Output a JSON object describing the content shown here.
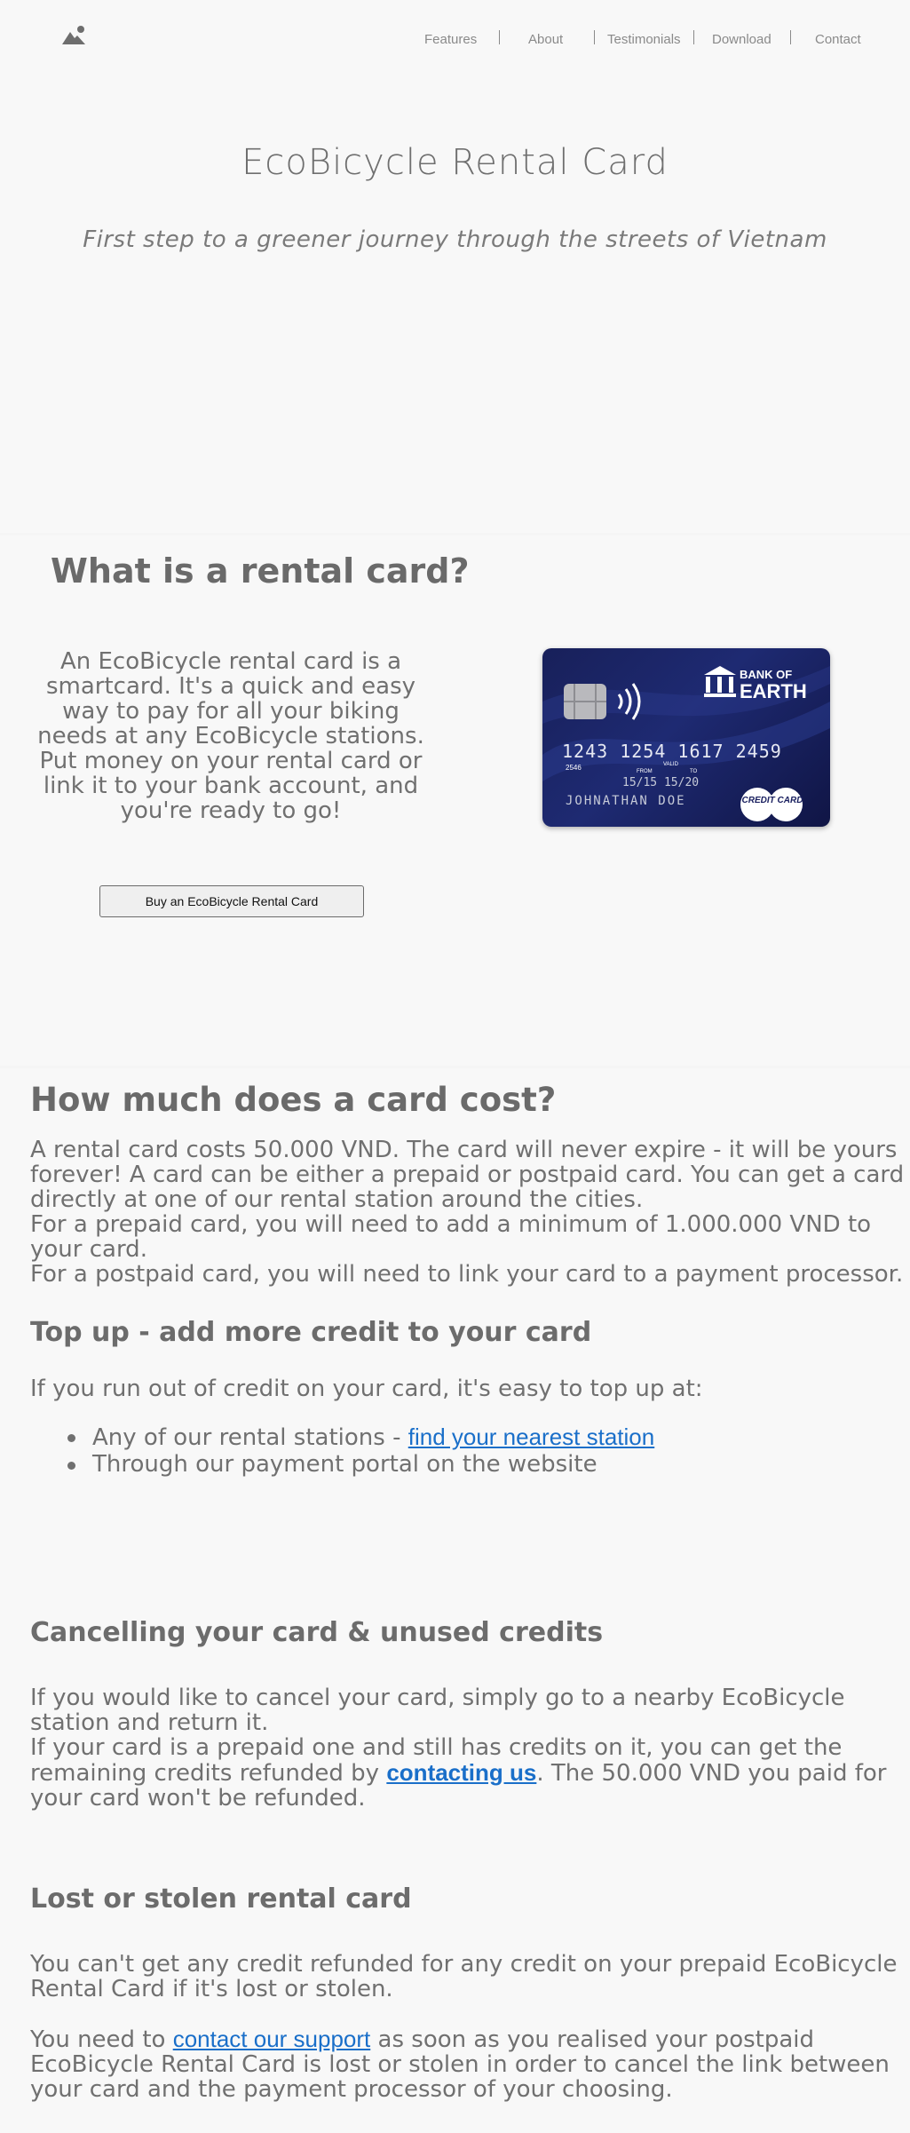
{
  "nav": {
    "items": [
      "Features",
      "About",
      "Testimonials",
      "Download",
      "Contact"
    ],
    "logo_icon": "mountain-sun-icon"
  },
  "hero": {
    "title": "EcoBicycle Rental Card",
    "subtitle": "First step to a greener journey through the streets of Vietnam"
  },
  "what": {
    "title": "What is a rental card?",
    "body": "An EcoBicycle rental card is a smartcard. It's a quick and easy way to pay for all your biking needs at any EcoBicycle stations. Put money on your rental card or link it to your bank account, and you're ready to go!",
    "button": "Buy an EcoBicycle Rental Card",
    "card": {
      "bank_line1": "BANK OF",
      "bank_line2": "EARTH",
      "number": "1243 1254 1617 2459",
      "small_number": "2546",
      "from_label": "FROM",
      "valid_label": "VALID",
      "to_label": "TO",
      "expiry": "15/15  15/20",
      "holder": "JOHNATHAN DOE",
      "type": "CREDIT CARD"
    }
  },
  "cost": {
    "title": "How much does a card cost?",
    "p1": "A rental card costs 50.000 VND. The card will never expire - it will be yours forever! A card can be either a prepaid or postpaid card. You can get a card directly at one of our rental station around the cities.",
    "p2": "For a prepaid card, you will need to add a minimum of 1.000.000 VND to your card.",
    "p3": "For a postpaid card, you will need to link your card to a payment processor.",
    "topup_title": "Top up - add more credit to your card",
    "topup_intro": "If you run out of credit on your card, it's easy to top up at:",
    "topup_item1": "Any of our rental stations - ",
    "topup_item1_link": "find your nearest station",
    "topup_item2": "Through our payment portal on the website",
    "cancel_title": "Cancelling your card & unused credits",
    "cancel_p1": "If you would like to cancel your card, simply go to a nearby EcoBicycle station and return it.",
    "cancel_p2a": "If your card is a prepaid one and still has credits on it, you can get the remaining credits refunded by ",
    "cancel_p2_link": "contacting us",
    "cancel_p2b": ". The 50.000 VND you paid for your card won't be refunded.",
    "lost_title": "Lost or stolen rental card",
    "lost_p1": "You can't get any credit refunded for any credit on your prepaid EcoBicycle Rental Card if it's lost or stolen.",
    "lost_p2a": "You need to ",
    "lost_p2_link": "contact our support",
    "lost_p2b": " as soon as you realised your postpaid EcoBicycle Rental Card is lost or stolen in order to cancel the link between your card and the payment processor of your choosing."
  }
}
